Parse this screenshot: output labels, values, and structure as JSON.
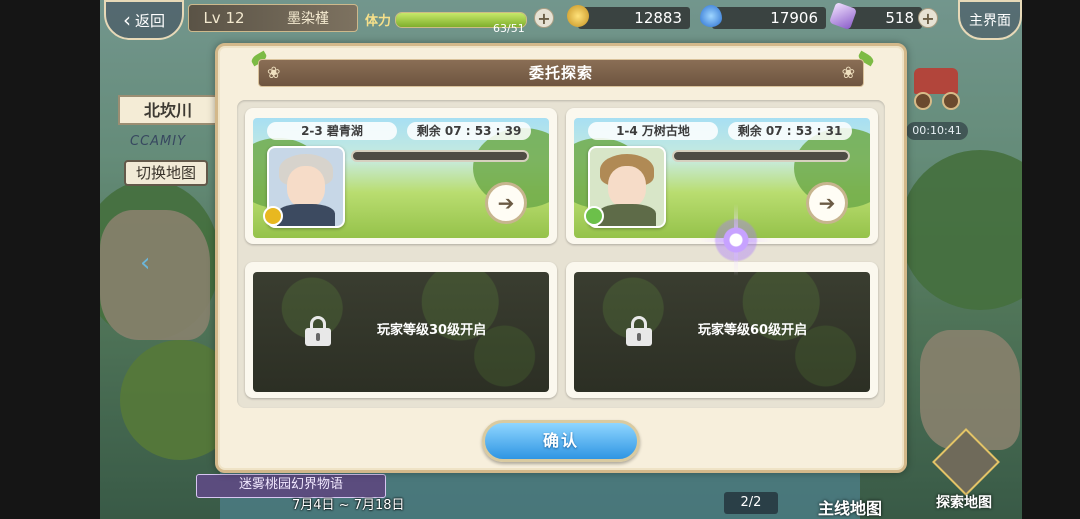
{
  "hud": {
    "back_label": "返回",
    "level": "Lv 12",
    "player_name": "墨染槿",
    "stamina_label": "体力",
    "stamina_value": "63/51",
    "stamina_fill_fraction": 1.0,
    "gold": "12883",
    "gems": "17906",
    "crystals": "518",
    "main_menu_label": "主界面"
  },
  "map": {
    "region_name": "北坎川",
    "region_sub": "CCAMIY",
    "switch_map": "切换地图",
    "event_banner": "迷雾桃园幻界物语",
    "event_date": "7月4日 ~ 7月18日",
    "page_indicator": "2/2",
    "main_map_label": "主线地图",
    "explore_map_label": "探索地图",
    "side_timer": "00:10:41"
  },
  "modal": {
    "title": "委托探索",
    "slots": [
      {
        "location": "2-3 碧青湖",
        "remaining": "剩余 07 : 53 : 39",
        "progress_fraction": 0.0
      },
      {
        "location": "1-4 万树古地",
        "remaining": "剩余 07 : 53 : 31",
        "progress_fraction": 0.0
      }
    ],
    "locked": [
      {
        "text": "玩家等级30级开启"
      },
      {
        "text": "玩家等级60级开启"
      }
    ],
    "confirm": "确认"
  },
  "colors": {
    "modal_bg": "#f7efdc",
    "title_bar": "#7a5f48",
    "confirm": "#3fa0e8",
    "panel": "#e7e2d3"
  }
}
